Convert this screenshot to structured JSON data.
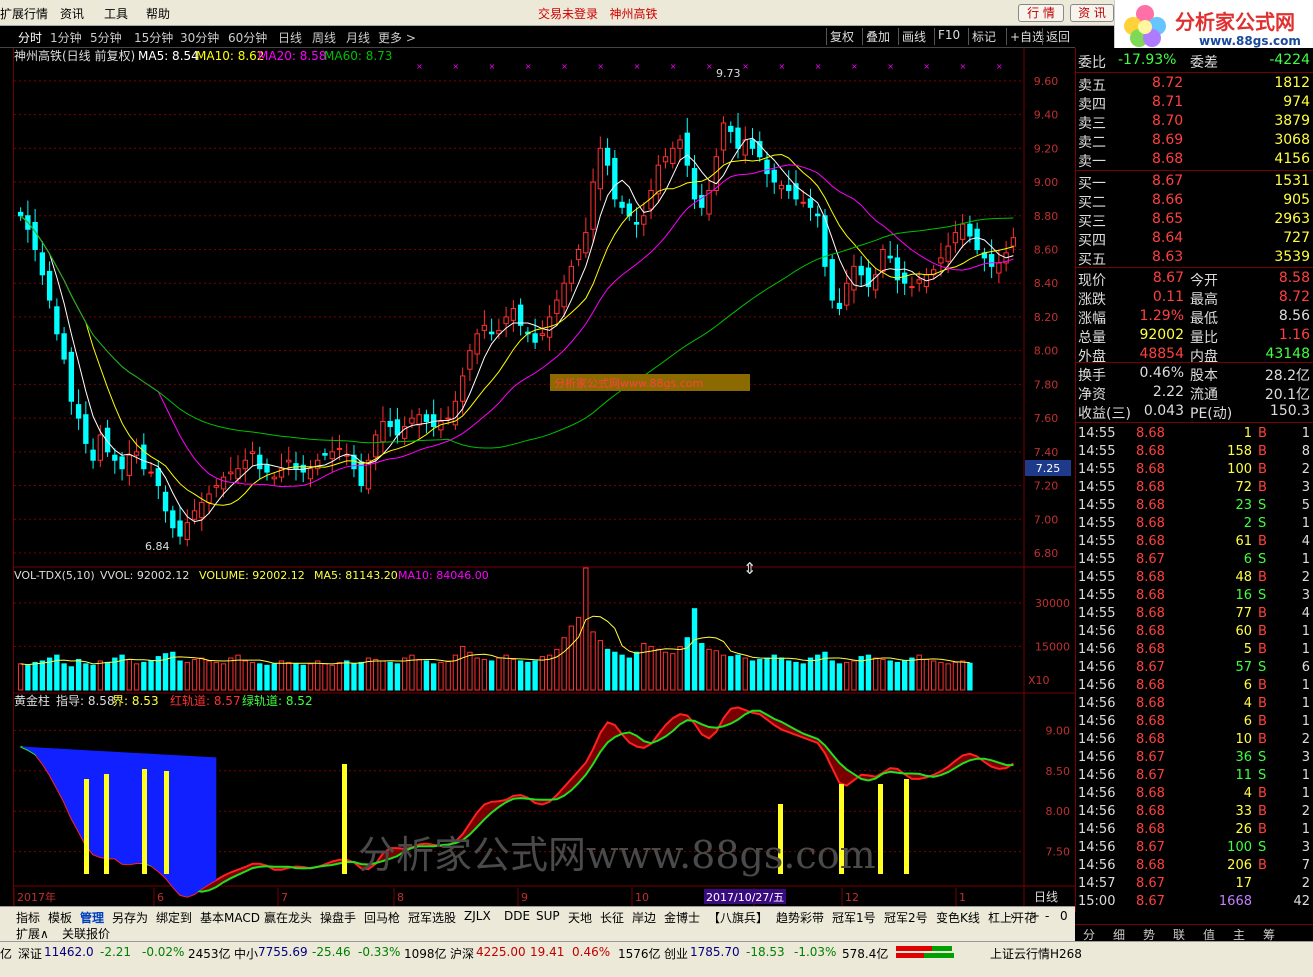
{
  "menu": {
    "items": [
      "扩展行情",
      "资讯",
      "工具",
      "帮助"
    ],
    "status_left": "交易未登录",
    "status_right": "神州高铁",
    "btn_quote": "行 情",
    "btn_news": "资 讯"
  },
  "logo": {
    "title": "分析家公式网",
    "url": "www.88gs.com"
  },
  "toolbar": {
    "periods": [
      "分时",
      "1分钟",
      "5分钟",
      "15分钟",
      "30分钟",
      "60分钟",
      "日线",
      "周线",
      "月线",
      "更多 >"
    ],
    "active_period": "分时",
    "right_buttons": [
      "复权",
      "叠加",
      "画线",
      "F10",
      "标记",
      "+自选",
      "返回"
    ]
  },
  "main_legend": {
    "name": "神州高铁(日线 前复权)",
    "ma5": "MA5: 8.54",
    "ma10": "MA10: 8.62",
    "ma20": "MA20: 8.58",
    "ma60": "MA60: 8.73"
  },
  "annotations": {
    "high": "9.73",
    "low": "6.84",
    "current_tag": "7.25",
    "watermark_small": "分析家公式网www.88gs.com",
    "watermark_big": "分析家公式网www.88gs.com"
  },
  "price_axis": [
    "9.60",
    "9.40",
    "9.20",
    "9.00",
    "8.80",
    "8.60",
    "8.40",
    "8.20",
    "8.00",
    "7.80",
    "7.60",
    "7.40",
    "7.20",
    "7.00",
    "6.80"
  ],
  "vol_legend": {
    "name": "VOL-TDX(5,10)",
    "vvol": "VVOL: 92002.12",
    "volume": "VOLUME: 92002.12",
    "ma5": "MA5: 81143.20",
    "ma10": "MA10: 84046.00"
  },
  "vol_axis": [
    "30000",
    "15000"
  ],
  "vol_unit": "X10",
  "gold_legend": {
    "name": "黄金柱",
    "guide": "指导: 8.58",
    "bound": "界: 8.53",
    "red": "红轨道: 8.57",
    "green": "绿轨道: 8.52"
  },
  "gold_axis": [
    "9.00",
    "8.50",
    "8.00",
    "7.50"
  ],
  "time_axis": {
    "labels": [
      "2017年",
      "6",
      "7",
      "8",
      "9",
      "10",
      "11",
      "12",
      "1"
    ],
    "highlight": "2017/10/27/五",
    "period": "日线"
  },
  "quote": {
    "weibi_label": "委比",
    "weibi": "-17.93%",
    "weicha_label": "委差",
    "weicha": "-4224",
    "sell": [
      {
        "label": "卖五",
        "price": "8.72",
        "vol": "1812"
      },
      {
        "label": "卖四",
        "price": "8.71",
        "vol": "974"
      },
      {
        "label": "卖三",
        "price": "8.70",
        "vol": "3879"
      },
      {
        "label": "卖二",
        "price": "8.69",
        "vol": "3068"
      },
      {
        "label": "卖一",
        "price": "8.68",
        "vol": "4156"
      }
    ],
    "buy": [
      {
        "label": "买一",
        "price": "8.67",
        "vol": "1531"
      },
      {
        "label": "买二",
        "price": "8.66",
        "vol": "905"
      },
      {
        "label": "买三",
        "price": "8.65",
        "vol": "2963"
      },
      {
        "label": "买四",
        "price": "8.64",
        "vol": "727"
      },
      {
        "label": "买五",
        "price": "8.63",
        "vol": "3539"
      }
    ],
    "stats": [
      {
        "l1": "现价",
        "v1": "8.67",
        "c1": "#ff4040",
        "l2": "今开",
        "v2": "8.58",
        "c2": "#ff4040"
      },
      {
        "l1": "涨跌",
        "v1": "0.11",
        "c1": "#ff4040",
        "l2": "最高",
        "v2": "8.72",
        "c2": "#ff4040"
      },
      {
        "l1": "涨幅",
        "v1": "1.29%",
        "c1": "#ff4040",
        "l2": "最低",
        "v2": "8.56",
        "c2": "#dddddd"
      },
      {
        "l1": "总量",
        "v1": "92002",
        "c1": "#ffff40",
        "l2": "量比",
        "v2": "1.16",
        "c2": "#ff4040"
      },
      {
        "l1": "外盘",
        "v1": "48854",
        "c1": "#ff4040",
        "l2": "内盘",
        "v2": "43148",
        "c2": "#40ff40"
      },
      {
        "l1": "换手",
        "v1": "0.46%",
        "c1": "#dddddd",
        "l2": "股本",
        "v2": "28.2亿",
        "c2": "#dddddd"
      },
      {
        "l1": "净资",
        "v1": "2.22",
        "c1": "#dddddd",
        "l2": "流通",
        "v2": "20.1亿",
        "c2": "#dddddd"
      },
      {
        "l1": "收益(三)",
        "v1": "0.043",
        "c1": "#dddddd",
        "l2": "PE(动)",
        "v2": "150.3",
        "c2": "#dddddd"
      }
    ],
    "ticks": [
      {
        "t": "14:55",
        "p": "8.68",
        "v": "1",
        "bs": "B",
        "n": "1"
      },
      {
        "t": "14:55",
        "p": "8.68",
        "v": "158",
        "bs": "B",
        "n": "8"
      },
      {
        "t": "14:55",
        "p": "8.68",
        "v": "100",
        "bs": "B",
        "n": "2"
      },
      {
        "t": "14:55",
        "p": "8.68",
        "v": "72",
        "bs": "B",
        "n": "3"
      },
      {
        "t": "14:55",
        "p": "8.68",
        "v": "23",
        "bs": "S",
        "n": "5"
      },
      {
        "t": "14:55",
        "p": "8.68",
        "v": "2",
        "bs": "S",
        "n": "1"
      },
      {
        "t": "14:55",
        "p": "8.68",
        "v": "61",
        "bs": "B",
        "n": "4"
      },
      {
        "t": "14:55",
        "p": "8.67",
        "v": "6",
        "bs": "S",
        "n": "1"
      },
      {
        "t": "14:55",
        "p": "8.68",
        "v": "48",
        "bs": "B",
        "n": "2"
      },
      {
        "t": "14:55",
        "p": "8.68",
        "v": "16",
        "bs": "S",
        "n": "3"
      },
      {
        "t": "14:55",
        "p": "8.68",
        "v": "77",
        "bs": "B",
        "n": "4"
      },
      {
        "t": "14:56",
        "p": "8.68",
        "v": "60",
        "bs": "B",
        "n": "1"
      },
      {
        "t": "14:56",
        "p": "8.68",
        "v": "5",
        "bs": "B",
        "n": "1"
      },
      {
        "t": "14:56",
        "p": "8.67",
        "v": "57",
        "bs": "S",
        "n": "6"
      },
      {
        "t": "14:56",
        "p": "8.68",
        "v": "6",
        "bs": "B",
        "n": "1"
      },
      {
        "t": "14:56",
        "p": "8.68",
        "v": "4",
        "bs": "B",
        "n": "1"
      },
      {
        "t": "14:56",
        "p": "8.68",
        "v": "6",
        "bs": "B",
        "n": "1"
      },
      {
        "t": "14:56",
        "p": "8.68",
        "v": "10",
        "bs": "B",
        "n": "2"
      },
      {
        "t": "14:56",
        "p": "8.67",
        "v": "36",
        "bs": "S",
        "n": "3"
      },
      {
        "t": "14:56",
        "p": "8.67",
        "v": "11",
        "bs": "S",
        "n": "1"
      },
      {
        "t": "14:56",
        "p": "8.68",
        "v": "4",
        "bs": "B",
        "n": "1"
      },
      {
        "t": "14:56",
        "p": "8.68",
        "v": "33",
        "bs": "B",
        "n": "2"
      },
      {
        "t": "14:56",
        "p": "8.68",
        "v": "26",
        "bs": "B",
        "n": "1"
      },
      {
        "t": "14:56",
        "p": "8.67",
        "v": "100",
        "bs": "S",
        "n": "3"
      },
      {
        "t": "14:56",
        "p": "8.68",
        "v": "206",
        "bs": "B",
        "n": "7"
      },
      {
        "t": "14:57",
        "p": "8.67",
        "v": "17",
        "bs": "",
        "n": "2"
      },
      {
        "t": "15:00",
        "p": "8.67",
        "v": "1668",
        "bs": "",
        "n": "42"
      }
    ]
  },
  "bottom_tabs": [
    "指标",
    "模板",
    "管理",
    "另存为",
    "绑定到",
    "基本MACD",
    "赢在龙头",
    "操盘手",
    "回马枪",
    "冠军选股",
    "ZJLX",
    "DDE",
    "SUP",
    "天地",
    "长征",
    "岸边",
    "金博士",
    "【八旗兵】",
    "趋势彩带",
    "冠军1号",
    "冠军2号",
    "变色K线",
    "杠上开花"
  ],
  "bottom_tabs_active": "管理",
  "sub_tabs": [
    "扩展∧",
    "关联报价"
  ],
  "right_tabs": [
    "分",
    "细",
    "势",
    "联",
    "值",
    "主",
    "筹"
  ],
  "statusbar": {
    "item0": "亿",
    "sz_label": "深证",
    "sz_val": "11462.0",
    "sz_chg": "-2.21",
    "sz_pct": "-0.02%",
    "sz_amt": "2453亿",
    "zx_label": "中小",
    "zx_val": "7755.69",
    "zx_chg": "-25.46",
    "zx_pct": "-0.33%",
    "zx_amt": "1098亿",
    "hs_label": "沪深",
    "hs_val": "4225.00",
    "hs_chg": "19.41",
    "hs_pct": "0.46%",
    "hs_amt": "1576亿",
    "cy_label": "创业",
    "cy_val": "1785.70",
    "cy_chg": "-18.53",
    "cy_pct": "-1.03%",
    "cy_amt": "578.4亿",
    "server": "上证云行情H268"
  },
  "colors": {
    "up": "#ff3030",
    "down": "#00ffff",
    "ma5": "#ffffff",
    "ma10": "#ffff00",
    "ma20": "#ff00ff",
    "ma60": "#00c000",
    "grid": "#7a0000"
  },
  "chart_data": [
    {
      "type": "candlestick",
      "title": "神州高铁(日线 前复权)",
      "ylim": [
        6.8,
        9.7
      ],
      "series": [
        {
          "name": "close",
          "values": [
            8.8,
            8.72,
            8.6,
            8.45,
            8.3,
            8.1,
            7.95,
            7.7,
            7.6,
            7.45,
            7.35,
            7.5,
            7.4,
            7.35,
            7.3,
            7.38,
            7.4,
            7.3,
            7.28,
            7.2,
            7.05,
            6.95,
            6.9,
            6.98,
            7.05,
            7.1,
            7.15,
            7.2,
            7.25,
            7.28,
            7.3,
            7.35,
            7.4,
            7.3,
            7.28,
            7.25,
            7.3,
            7.35,
            7.3,
            7.28,
            7.3,
            7.35,
            7.38,
            7.4,
            7.42,
            7.38,
            7.3,
            7.2,
            7.35,
            7.5,
            7.58,
            7.55,
            7.5,
            7.55,
            7.6,
            7.62,
            7.58,
            7.55,
            7.58,
            7.6,
            7.7,
            7.85,
            8.0,
            8.1,
            8.15,
            8.1,
            8.12,
            8.2,
            8.25,
            8.15,
            8.1,
            8.05,
            8.1,
            8.2,
            8.3,
            8.4,
            8.5,
            8.6,
            8.7,
            9.0,
            9.2,
            9.1,
            8.9,
            8.85,
            8.8,
            8.75,
            8.8,
            8.95,
            9.1,
            9.15,
            9.2,
            9.25,
            9.1,
            8.9,
            8.85,
            8.95,
            9.15,
            9.35,
            9.3,
            9.2,
            9.25,
            9.2,
            9.15,
            9.05,
            9.0,
            8.98,
            8.95,
            8.9,
            8.88,
            8.85,
            8.8,
            8.5,
            8.3,
            8.25,
            8.4,
            8.5,
            8.45,
            8.38,
            8.45,
            8.6,
            8.55,
            8.42,
            8.4,
            8.38,
            8.42,
            8.45,
            8.48,
            8.55,
            8.62,
            8.7,
            8.75,
            8.68,
            8.6,
            8.55,
            8.5,
            8.52,
            8.58,
            8.67
          ]
        },
        {
          "name": "MA5",
          "values": [
            8.54
          ]
        },
        {
          "name": "MA10",
          "values": [
            8.62
          ]
        },
        {
          "name": "MA20",
          "values": [
            8.58
          ]
        },
        {
          "name": "MA60",
          "values": [
            8.73
          ]
        }
      ]
    },
    {
      "type": "bar",
      "title": "VOL-TDX(5,10)",
      "ylim": [
        0,
        42000
      ],
      "series": [
        {
          "name": "VOLUME",
          "values": [
            9000,
            8500,
            9500,
            10000,
            11000,
            12000,
            9000,
            8000,
            10500,
            9000,
            8500,
            10000,
            9500,
            11000,
            12000,
            10500,
            9000,
            9500,
            10000,
            11500,
            12500,
            13000,
            10000,
            9500,
            10500,
            11000,
            10000,
            9500,
            9000,
            11000,
            12000,
            10000,
            9500,
            9000,
            8500,
            9000,
            10000,
            9500,
            9000,
            8500,
            9000,
            10000,
            9000,
            8500,
            9500,
            10000,
            9000,
            9500,
            11000,
            10500,
            10000,
            9500,
            9000,
            11000,
            12000,
            10500,
            10000,
            9000,
            9500,
            10000,
            12000,
            15000,
            13000,
            11000,
            10500,
            10000,
            11000,
            12000,
            10500,
            10000,
            9500,
            10000,
            11500,
            12000,
            14000,
            18000,
            22000,
            25000,
            42000,
            20000,
            17000,
            14000,
            13000,
            12000,
            11000,
            13000,
            16000,
            15000,
            14000,
            13000,
            12500,
            15000,
            18000,
            28000,
            16000,
            14000,
            13500,
            12000,
            11500,
            12000,
            11000,
            10000,
            10500,
            11000,
            12000,
            11000,
            10000,
            9500,
            9000,
            11000,
            12000,
            13000,
            10000,
            9000,
            9500,
            10000,
            11500,
            12000,
            11000,
            10500,
            10000,
            9500,
            10000,
            11000,
            12000,
            10500,
            10000,
            9500,
            9000,
            9500,
            10000,
            9200
          ]
        },
        {
          "name": "MA5",
          "values": [
            81143.2
          ]
        },
        {
          "name": "MA10",
          "values": [
            84046.0
          ]
        }
      ]
    },
    {
      "type": "line",
      "title": "黄金柱",
      "ylim": [
        7.1,
        9.4
      ],
      "series": [
        {
          "name": "指导",
          "values": [
            8.58
          ]
        },
        {
          "name": "界",
          "values": [
            8.53
          ]
        },
        {
          "name": "红轨道",
          "values": [
            8.57
          ]
        },
        {
          "name": "绿轨道",
          "values": [
            8.52
          ]
        }
      ]
    }
  ]
}
